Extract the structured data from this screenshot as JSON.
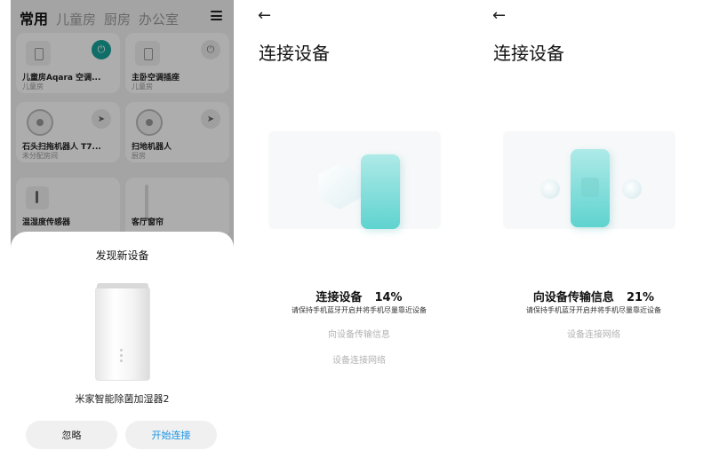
{
  "home": {
    "tabs": [
      "常用",
      "儿童房",
      "厨房",
      "办公室"
    ],
    "devices": [
      {
        "name": "儿童房Aqara 空调...",
        "room": "儿童房"
      },
      {
        "name": "主卧空调插座",
        "room": "儿童房"
      },
      {
        "name": "石头扫拖机器人 T7...",
        "room": "未分配房间"
      },
      {
        "name": "扫地机器人",
        "room": "厨房"
      },
      {
        "name": "温湿度传感器",
        "room": ""
      },
      {
        "name": "客厅窗帘",
        "room": ""
      }
    ]
  },
  "discover_sheet": {
    "title": "发现新设备",
    "device_name": "米家智能除菌加湿器2",
    "ignore_label": "忽略",
    "connect_label": "开始连接"
  },
  "connect_screen_1": {
    "back_icon": "←",
    "title": "连接设备",
    "status_label": "连接设备",
    "progress_text": "14%",
    "progress": 0.14,
    "hint": "请保持手机蓝牙开启并将手机尽量靠近设备",
    "next_steps": [
      "向设备传输信息",
      "设备连接网络"
    ]
  },
  "connect_screen_2": {
    "back_icon": "←",
    "title": "连接设备",
    "status_label": "向设备传输信息",
    "progress_text": "21%",
    "progress": 0.21,
    "hint": "请保持手机蓝牙开启并将手机尽量靠近设备",
    "next_steps": [
      "设备连接网络"
    ]
  },
  "colors": {
    "accent_blue": "#1a96e6",
    "power_on_teal": "#17a39a",
    "phone_teal": "#5fd3cf"
  }
}
